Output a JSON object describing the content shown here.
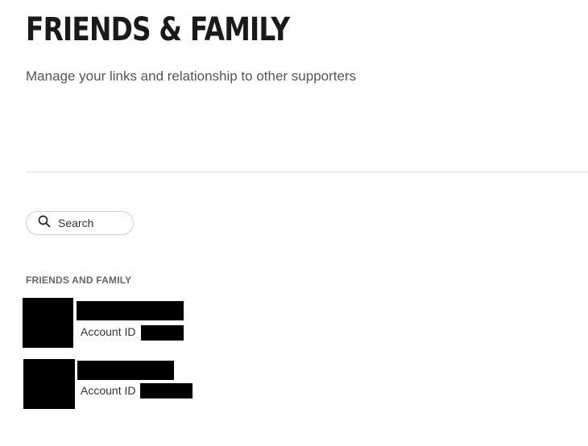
{
  "page": {
    "title": "FRIENDS & FAMILY",
    "subtitle": "Manage your links and relationship to other supporters"
  },
  "search": {
    "placeholder": "Search",
    "value": ""
  },
  "section": {
    "label": "FRIENDS AND FAMILY"
  },
  "members": [
    {
      "account_label": "Account ID",
      "name": "[redacted]",
      "account_id": "[redacted]"
    },
    {
      "account_label": "Account ID",
      "name": "[redacted]",
      "account_id": "[redacted]"
    }
  ],
  "colors": {
    "text_dark": "#1a1a1a",
    "text_muted": "#555555",
    "divider": "#dcdcdc",
    "redaction": "#000000"
  }
}
